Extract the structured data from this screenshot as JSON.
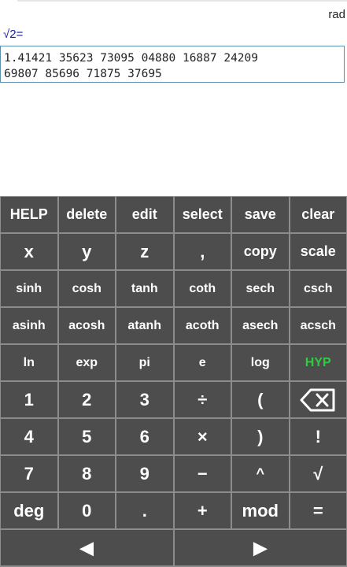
{
  "status": {
    "mode": "rad"
  },
  "expression": "√2=",
  "result": {
    "line1": "1.41421 35623 73095 04880 16887 24209",
    "line2": "69807 85696 71875 37695"
  },
  "keys": {
    "row1": [
      "HELP",
      "delete",
      "edit",
      "select",
      "save",
      "clear"
    ],
    "row2": [
      "x",
      "y",
      "z",
      ",",
      "copy",
      "scale"
    ],
    "row3": [
      "sinh",
      "cosh",
      "tanh",
      "coth",
      "sech",
      "csch"
    ],
    "row4": [
      "asinh",
      "acosh",
      "atanh",
      "acoth",
      "asech",
      "acsch"
    ],
    "row5": [
      "ln",
      "exp",
      "pi",
      "e",
      "log",
      "HYP"
    ],
    "row6": [
      "1",
      "2",
      "3",
      "÷",
      "("
    ],
    "row7": [
      "4",
      "5",
      "6",
      "×",
      ")",
      "!"
    ],
    "row8": [
      "7",
      "8",
      "9",
      "−",
      "^",
      "√"
    ],
    "row9": [
      "deg",
      "0",
      ".",
      "+",
      "mod",
      "="
    ],
    "row10": [
      "◀",
      "▶"
    ]
  },
  "colors": {
    "key_bg": "#4d4d4d",
    "keypad_bg": "#8c8c8c",
    "hyp_active": "#2ecc40",
    "result_border": "#5a8fb0"
  },
  "icons": {
    "backspace": "backspace-icon",
    "left": "left-arrow-icon",
    "right": "right-arrow-icon"
  }
}
